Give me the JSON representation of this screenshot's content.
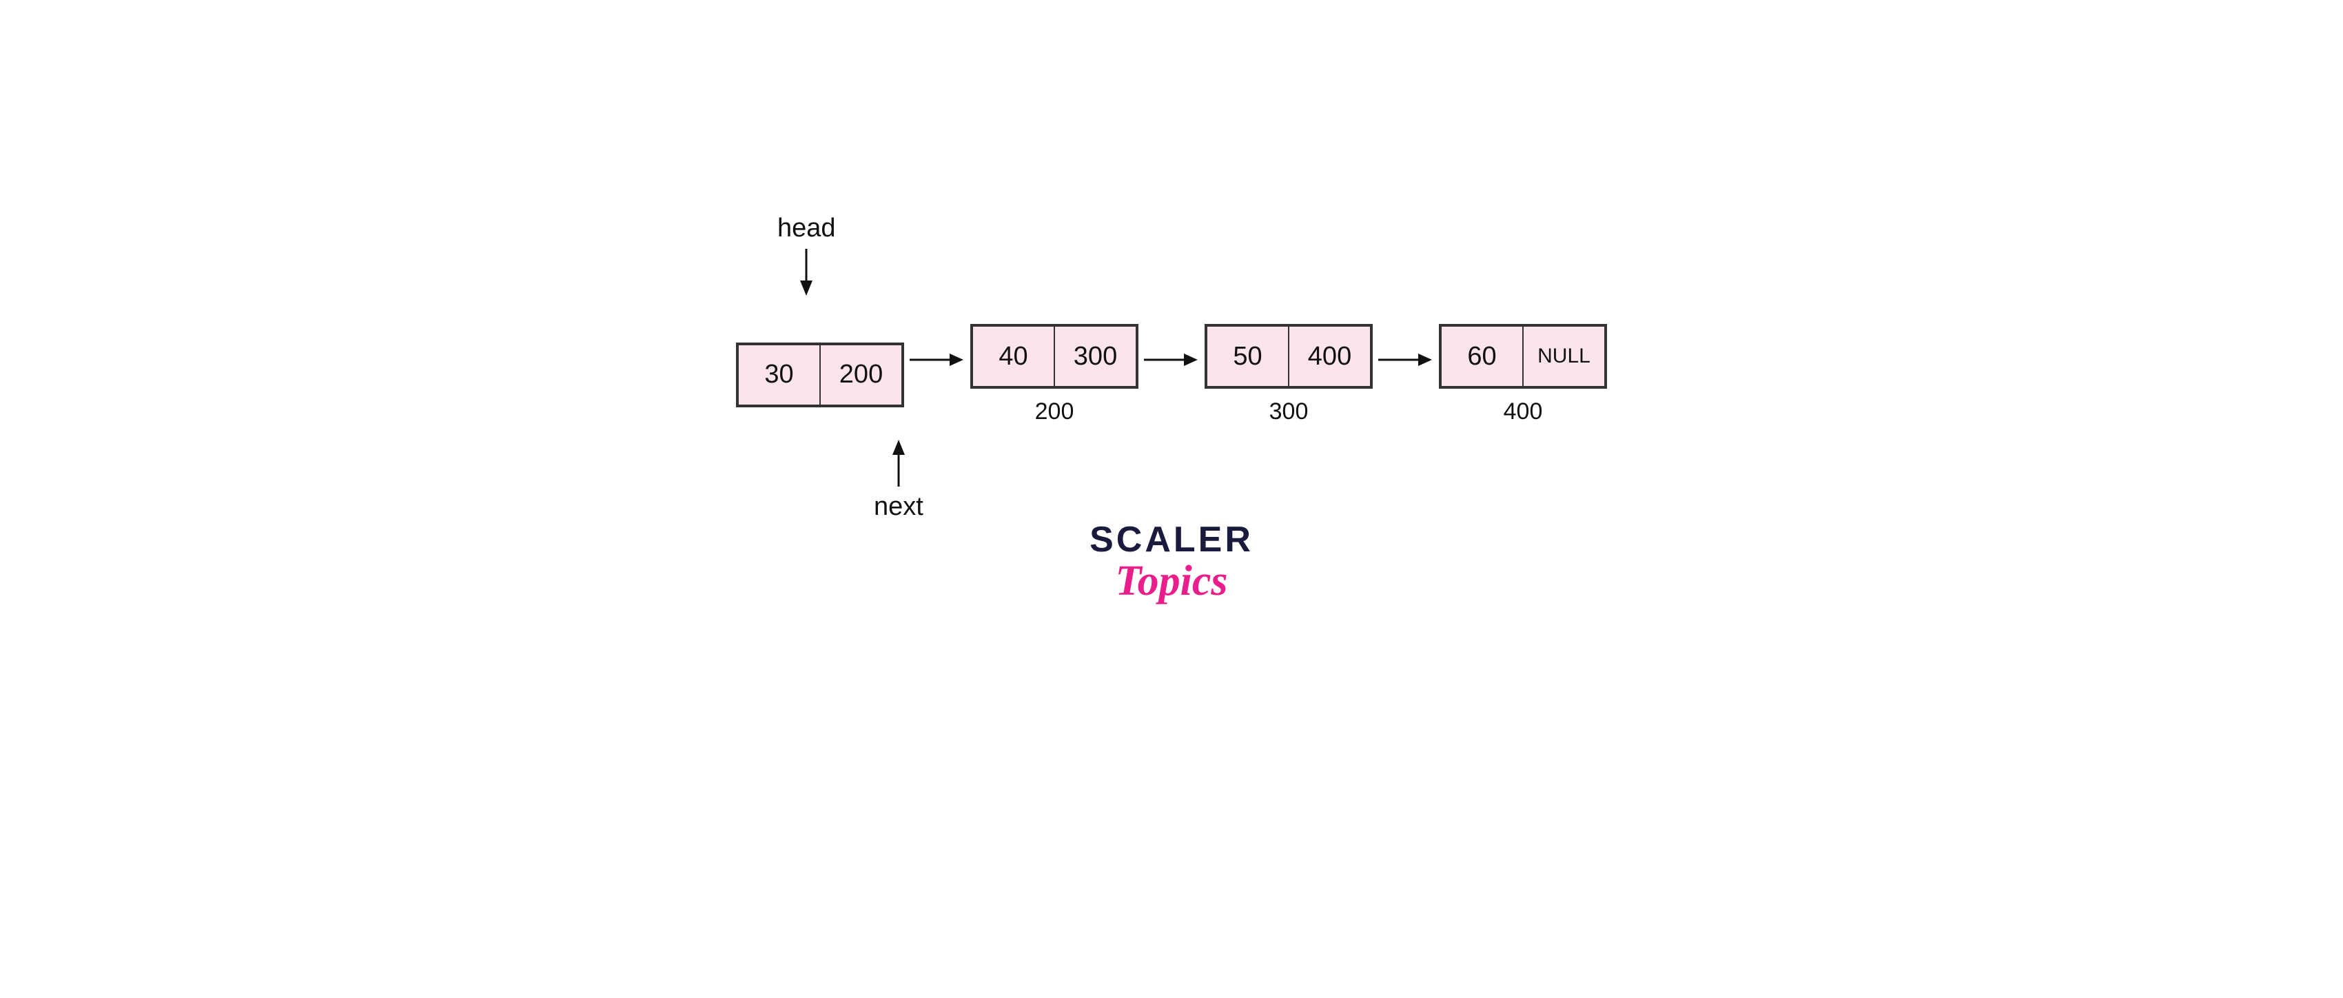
{
  "diagram": {
    "head_label": "head",
    "next_label": "next",
    "nodes": [
      {
        "data": "30",
        "pointer": "200",
        "address": null
      },
      {
        "data": "40",
        "pointer": "300",
        "address": "200"
      },
      {
        "data": "50",
        "pointer": "400",
        "address": "300"
      },
      {
        "data": "60",
        "pointer": "NULL",
        "address": "400"
      }
    ]
  },
  "branding": {
    "scaler": "SCALER",
    "topics": "Topics"
  },
  "colors": {
    "node_bg": "#fce4ec",
    "node_border": "#333333",
    "arrow_color": "#111111",
    "brand_dark": "#1a1a3e",
    "brand_pink": "#e91e8c"
  }
}
